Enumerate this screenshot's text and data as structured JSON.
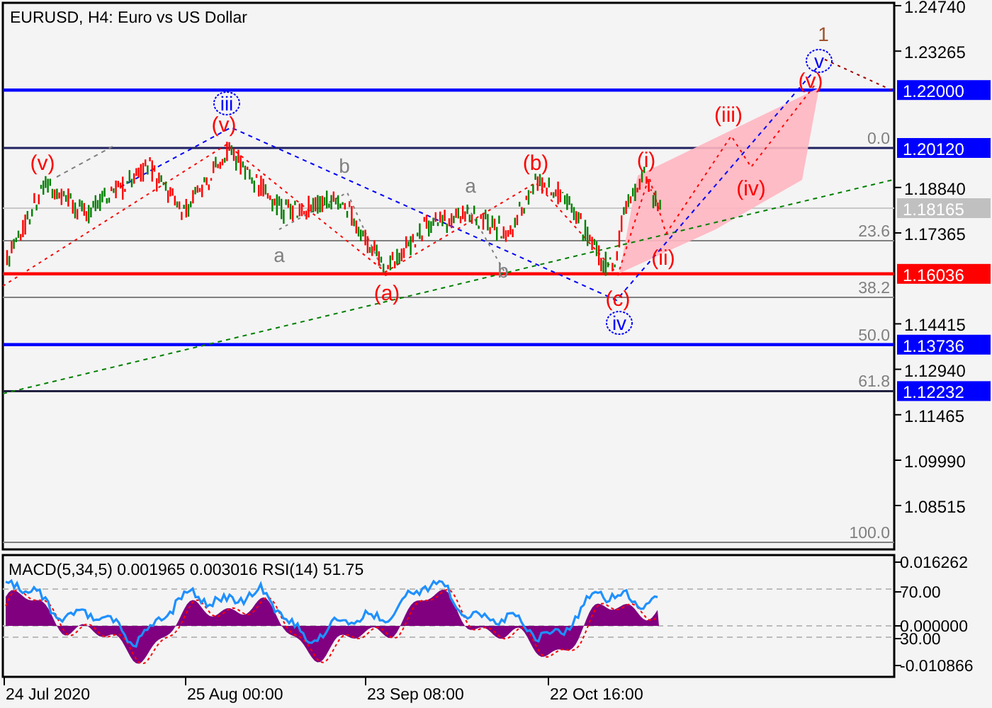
{
  "title": "EURUSD, H4:  Euro vs US Dollar",
  "price_axis": [
    "1.24740",
    "1.23265",
    "1.18840",
    "1.17365",
    "1.14415",
    "1.12940",
    "1.11465",
    "1.09990",
    "1.08515"
  ],
  "price_tags": [
    {
      "label": "1.22000",
      "color": "#0000ff"
    },
    {
      "label": "1.20120",
      "color": "#0000ff"
    },
    {
      "label": "1.18165",
      "color": "#c0c0c0"
    },
    {
      "label": "1.16036",
      "color": "#ff0000"
    },
    {
      "label": "1.13736",
      "color": "#0000ff"
    },
    {
      "label": "1.12232",
      "color": "#0000ff"
    }
  ],
  "fib_levels": [
    "0.0",
    "23.6",
    "38.2",
    "50.0",
    "61.8",
    "100.0"
  ],
  "wave_labels": [
    {
      "text": "(v)",
      "kind": "minor"
    },
    {
      "text": "iii",
      "kind": "intermediate"
    },
    {
      "text": "(v)",
      "kind": "minor"
    },
    {
      "text": "b",
      "kind": "correction"
    },
    {
      "text": "a",
      "kind": "correction"
    },
    {
      "text": "(b)",
      "kind": "minor"
    },
    {
      "text": "(i)",
      "kind": "minor"
    },
    {
      "text": "(iii)",
      "kind": "minor"
    },
    {
      "text": "1",
      "kind": "primary"
    },
    {
      "text": "v",
      "kind": "intermediate"
    },
    {
      "text": "(v)",
      "kind": "minor"
    },
    {
      "text": "(iv)",
      "kind": "minor"
    },
    {
      "text": "a",
      "kind": "correction"
    },
    {
      "text": "(ii)",
      "kind": "minor"
    },
    {
      "text": "b",
      "kind": "correction"
    },
    {
      "text": "(a)",
      "kind": "minor"
    },
    {
      "text": "(c)",
      "kind": "minor"
    },
    {
      "text": "iv",
      "kind": "intermediate"
    }
  ],
  "indicator": {
    "legend": "MACD(5,34,5) 0.001965 0.003016 RSI(14) 51.75",
    "axis": [
      "0.016262",
      "70.00",
      "0.000000",
      "30.00",
      "-0.010866"
    ]
  },
  "time_axis": [
    "24 Jul 2020",
    "25 Aug 00:00",
    "23 Sep 08:00",
    "22 Oct 16:00"
  ]
}
